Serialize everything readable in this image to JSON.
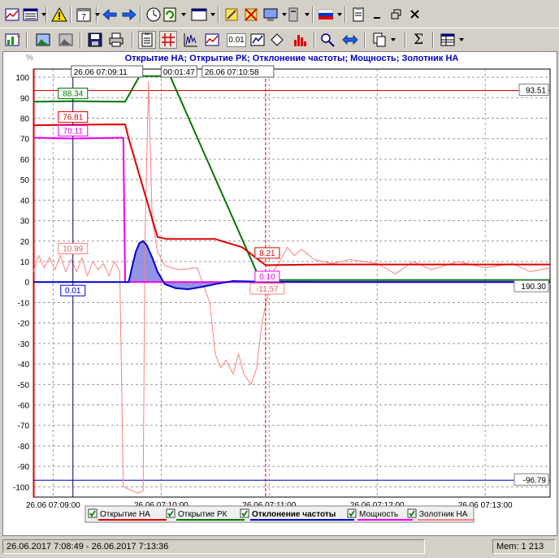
{
  "toolbar_top": {
    "buttons": [
      {
        "name": "line-chart-menu-button",
        "icon": "line-chart-icon"
      },
      {
        "name": "list-view-menu-button",
        "icon": "list-view-icon"
      },
      {
        "name": "warning-button",
        "icon": "warning-icon"
      },
      {
        "name": "calendar-menu-button",
        "icon": "calendar-icon",
        "text": "7"
      },
      {
        "name": "back-button",
        "icon": "arrow-left-icon"
      },
      {
        "name": "forward-button",
        "icon": "arrow-right-icon"
      },
      {
        "name": "clock-button",
        "icon": "clock-icon"
      },
      {
        "name": "refresh-button",
        "icon": "refresh-icon"
      },
      {
        "name": "window-menu-button",
        "icon": "window-icon"
      },
      {
        "name": "tools-button",
        "icon": "tools-icon"
      },
      {
        "name": "tools-disable-button",
        "icon": "tools-disabled-icon"
      },
      {
        "name": "monitor-menu-button",
        "icon": "monitor-icon"
      },
      {
        "name": "device-menu-button",
        "icon": "device-icon"
      },
      {
        "name": "language-menu-button",
        "icon": "russian-flag-icon"
      },
      {
        "name": "report-button",
        "icon": "report-icon"
      },
      {
        "name": "minimize-button",
        "icon": "minimize-icon"
      },
      {
        "name": "restore-button",
        "icon": "restore-icon"
      },
      {
        "name": "close-button",
        "icon": "close-icon"
      }
    ]
  },
  "toolbar_bottom": {
    "zoom_value": "0.01",
    "sum_symbol": "Σ",
    "buttons": [
      {
        "name": "add-chart-button",
        "icon": "add-chart-icon"
      },
      {
        "name": "image-button",
        "icon": "image-icon"
      },
      {
        "name": "image-gray-button",
        "icon": "image-gray-icon"
      },
      {
        "name": "save-button",
        "icon": "floppy-disk-icon"
      },
      {
        "name": "print-button",
        "icon": "printer-icon"
      },
      {
        "name": "properties-button",
        "icon": "properties-icon"
      },
      {
        "name": "grid-button",
        "icon": "grid-icon"
      },
      {
        "name": "bar-chart-button",
        "icon": "bar-chart-icon"
      },
      {
        "name": "line-chart-button",
        "icon": "line-chart-icon"
      },
      {
        "name": "zoom-value-button",
        "icon": "zoom-icon"
      },
      {
        "name": "scale-button",
        "icon": "scale-icon"
      },
      {
        "name": "marker-button",
        "icon": "diamond-icon"
      },
      {
        "name": "histogram-button",
        "icon": "histogram-icon"
      },
      {
        "name": "zoom-reset-button",
        "icon": "zoom-reset-icon"
      },
      {
        "name": "horizontal-scroll-button",
        "icon": "double-arrow-icon"
      },
      {
        "name": "copy-menu-button",
        "icon": "copy-icon"
      },
      {
        "name": "sum-button",
        "icon": "sum-icon"
      },
      {
        "name": "table-menu-button",
        "icon": "table-icon"
      }
    ]
  },
  "colors": {
    "otkrytie_na": "#dd0000",
    "otkrytie_rk": "#007700",
    "otklonenie": "#0000cc",
    "moshchnost": "#ee00ee",
    "zolotnik": "#ff7f7f",
    "title": "#0000cc"
  },
  "chart_data": {
    "type": "line",
    "title": "Открытие НА; Открытие РК; Отклонение частоты; Мощность; Золотник НА",
    "ylabel": "%",
    "ylim": [
      -105,
      104
    ],
    "xlim": [
      "26.06 07:08:49",
      "26.06 07:13:36"
    ],
    "yticks": [
      "100",
      "90",
      "80",
      "70",
      "60",
      "50",
      "40",
      "30",
      "20",
      "10",
      "0",
      "-10",
      "-20",
      "-30",
      "-40",
      "-50",
      "-60",
      "-70",
      "-80",
      "-90",
      "-100"
    ],
    "xticks": [
      "26.06 07:09:00",
      "26.06 07:10:00",
      "26.06 07:11:00",
      "26.06 07:12:00",
      "26.06 07:13:00"
    ],
    "series": [
      {
        "name": "Открытие НА",
        "points": [
          [
            "07:08:49",
            76.5
          ],
          [
            "07:09:11",
            76.81
          ],
          [
            "07:09:40",
            77
          ],
          [
            "07:09:42",
            70
          ],
          [
            "07:09:58",
            22
          ],
          [
            "07:10:03",
            21
          ],
          [
            "07:10:30",
            21
          ],
          [
            "07:10:45",
            17
          ],
          [
            "07:10:58",
            8.21
          ],
          [
            "07:11:30",
            8.6
          ],
          [
            "07:12:00",
            8.6
          ],
          [
            "07:13:36",
            8.6
          ]
        ]
      },
      {
        "name": "Открытие РК",
        "points": [
          [
            "07:08:49",
            88
          ],
          [
            "07:09:11",
            88.34
          ],
          [
            "07:09:40",
            88
          ],
          [
            "07:09:48",
            100.5
          ],
          [
            "07:10:05",
            100.5
          ],
          [
            "07:10:55",
            1
          ],
          [
            "07:10:58",
            1
          ],
          [
            "07:12:00",
            1
          ],
          [
            "07:13:36",
            1
          ]
        ]
      },
      {
        "name": "Отклонение частоты",
        "points": [
          [
            "07:08:49",
            0
          ],
          [
            "07:09:42",
            0
          ],
          [
            "07:09:44",
            8
          ],
          [
            "07:09:46",
            15
          ],
          [
            "07:09:48",
            19
          ],
          [
            "07:09:50",
            20
          ],
          [
            "07:09:52",
            18
          ],
          [
            "07:09:55",
            12
          ],
          [
            "07:09:58",
            5
          ],
          [
            "07:10:02",
            -1
          ],
          [
            "07:10:08",
            -3
          ],
          [
            "07:10:15",
            -3.5
          ],
          [
            "07:10:22",
            -2.5
          ],
          [
            "07:10:30",
            -1
          ],
          [
            "07:10:40",
            0.5
          ],
          [
            "07:10:58",
            0.1
          ],
          [
            "07:11:30",
            0
          ],
          [
            "07:12:00",
            0
          ],
          [
            "07:13:36",
            0
          ]
        ]
      },
      {
        "name": "Мощность",
        "points": [
          [
            "07:08:49",
            70.5
          ],
          [
            "07:09:11",
            70.11
          ],
          [
            "07:09:39",
            70.5
          ],
          [
            "07:09:40",
            0
          ],
          [
            "07:13:36",
            0
          ]
        ]
      },
      {
        "name": "Золотник НА",
        "points": [
          [
            "07:08:49",
            5
          ],
          [
            "07:08:52",
            13
          ],
          [
            "07:08:55",
            7
          ],
          [
            "07:08:58",
            12
          ],
          [
            "07:09:01",
            6
          ],
          [
            "07:09:04",
            13
          ],
          [
            "07:09:07",
            5
          ],
          [
            "07:09:10",
            11
          ],
          [
            "07:09:13",
            5
          ],
          [
            "07:09:16",
            12
          ],
          [
            "07:09:19",
            3
          ],
          [
            "07:09:22",
            10
          ],
          [
            "07:09:25",
            6
          ],
          [
            "07:09:28",
            9
          ],
          [
            "07:09:31",
            3
          ],
          [
            "07:09:34",
            10
          ],
          [
            "07:09:37",
            5
          ],
          [
            "07:09:39",
            -100
          ],
          [
            "07:09:47",
            -103
          ],
          [
            "07:09:50",
            -102
          ],
          [
            "07:09:51",
            20
          ],
          [
            "07:09:53",
            98
          ],
          [
            "07:09:55",
            30
          ],
          [
            "07:09:58",
            15
          ],
          [
            "07:10:02",
            8
          ],
          [
            "07:10:10",
            6
          ],
          [
            "07:10:20",
            7
          ],
          [
            "07:10:27",
            -10
          ],
          [
            "07:10:30",
            -35
          ],
          [
            "07:10:33",
            -42
          ],
          [
            "07:10:36",
            -38
          ],
          [
            "07:10:40",
            -45
          ],
          [
            "07:10:43",
            -35
          ],
          [
            "07:10:46",
            -45
          ],
          [
            "07:10:50",
            -50
          ],
          [
            "07:10:53",
            -42
          ],
          [
            "07:10:56",
            -20
          ],
          [
            "07:10:58",
            -11.57
          ],
          [
            "07:11:02",
            5
          ],
          [
            "07:11:06",
            10
          ],
          [
            "07:11:10",
            17
          ],
          [
            "07:11:14",
            13
          ],
          [
            "07:11:18",
            16
          ],
          [
            "07:11:25",
            11
          ],
          [
            "07:11:35",
            9
          ],
          [
            "07:11:45",
            11
          ],
          [
            "07:12:00",
            9
          ],
          [
            "07:12:10",
            4
          ],
          [
            "07:12:20",
            10
          ],
          [
            "07:12:30",
            6
          ],
          [
            "07:12:45",
            10
          ],
          [
            "07:13:00",
            7
          ],
          [
            "07:13:15",
            9
          ],
          [
            "07:13:25",
            5
          ],
          [
            "07:13:36",
            7
          ]
        ]
      }
    ],
    "hlines": [
      {
        "value": 93.51,
        "label": "93.51",
        "color": "#dd0000"
      },
      {
        "value": -96.79,
        "label": "-96.79",
        "color": "#0000cc"
      }
    ],
    "cursors": [
      {
        "time": "07:09:11",
        "label": "26.06 07:09:11",
        "color": "#000066"
      },
      {
        "time": "07:10:58",
        "label": "26.06 07:10:58",
        "color": "#dd0000"
      }
    ],
    "cursor_interval": "00:01:47",
    "cursor_values_left": [
      {
        "series": "Открытие РК",
        "value": "88.34",
        "color": "#007700"
      },
      {
        "series": "Открытие НА",
        "value": "76.81",
        "color": "#dd0000"
      },
      {
        "series": "Мощность",
        "value": "70.11",
        "color": "#ee00ee"
      },
      {
        "series": "Золотник НА",
        "value": "10.99",
        "color": "#ff7f7f"
      },
      {
        "series": "Отклонение частоты",
        "value": "0.01",
        "color": "#0000cc"
      }
    ],
    "cursor_values_right": [
      {
        "series": "Открытие НА",
        "value": "8.21",
        "color": "#dd0000"
      },
      {
        "series": "Отклонение частоты",
        "value": "0.10",
        "color": "#ee00ee"
      },
      {
        "series": "Золотник НА",
        "value": "-11.57",
        "color": "#ff7f7f"
      }
    ],
    "right_value": {
      "value": "190.30",
      "y": 0
    },
    "legend": [
      {
        "label": "Открытие НА",
        "color": "#dd0000",
        "checked": true,
        "bold": false
      },
      {
        "label": "Открытие РК",
        "color": "#007700",
        "checked": true,
        "bold": false
      },
      {
        "label": "Отклонение частоты",
        "color": "#0000cc",
        "checked": true,
        "bold": true
      },
      {
        "label": "Мощность",
        "color": "#ee00ee",
        "checked": true,
        "bold": false
      },
      {
        "label": "Золотник НА",
        "color": "#ff7f7f",
        "checked": true,
        "bold": false
      }
    ],
    "grid": true
  },
  "status": {
    "range": "26.06.2017 7:08:49 - 26.06.2017 7:13:36",
    "memory": "Mem: 1 213"
  }
}
